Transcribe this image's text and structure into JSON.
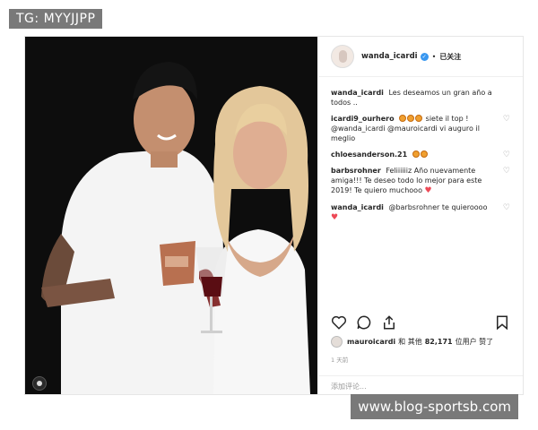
{
  "watermarks": {
    "top_left": "TG: MYYJJPP",
    "bottom_right": "www.blog-sportsb.com"
  },
  "post": {
    "username": "wanda_icardi",
    "verified_icon": "verified-badge-icon",
    "separator": "•",
    "follow_status": "已关注",
    "caption": {
      "user": "wanda_icardi",
      "text": "Les deseamos un gran año a todos .."
    },
    "comments": [
      {
        "user": "icardi9_ourhero",
        "emoji_count": 3,
        "text": "siete il top ! @wanda_icardi @mauroicardi vi auguro il meglio",
        "trailing_heart": false
      },
      {
        "user": "chloesanderson.21",
        "emoji_count": 2,
        "text": "",
        "trailing_heart": false
      },
      {
        "user": "barbsrohner",
        "emoji_count": 0,
        "text": "Feliiiiiiz Año nuevamente amiga!!! Te deseo todo lo mejor para este 2019! Te quiero muchooo",
        "trailing_heart": true
      },
      {
        "user": "wanda_icardi",
        "emoji_count": 0,
        "text": "@barbsrohner te quieroooo",
        "trailing_heart": true
      }
    ],
    "action_icons": [
      "heart-outline-icon",
      "comment-icon",
      "share-icon",
      "bookmark-icon"
    ],
    "likes": {
      "user": "mauroicardi",
      "conjunction": "和 其他",
      "count": "82,171",
      "suffix": "位用户 赞了"
    },
    "time": "1 天前",
    "add_comment_placeholder": "添加评论..."
  },
  "colors": {
    "link": "#3897f0",
    "like_heart": "#ed4956",
    "muted": "#8e8e8e"
  }
}
